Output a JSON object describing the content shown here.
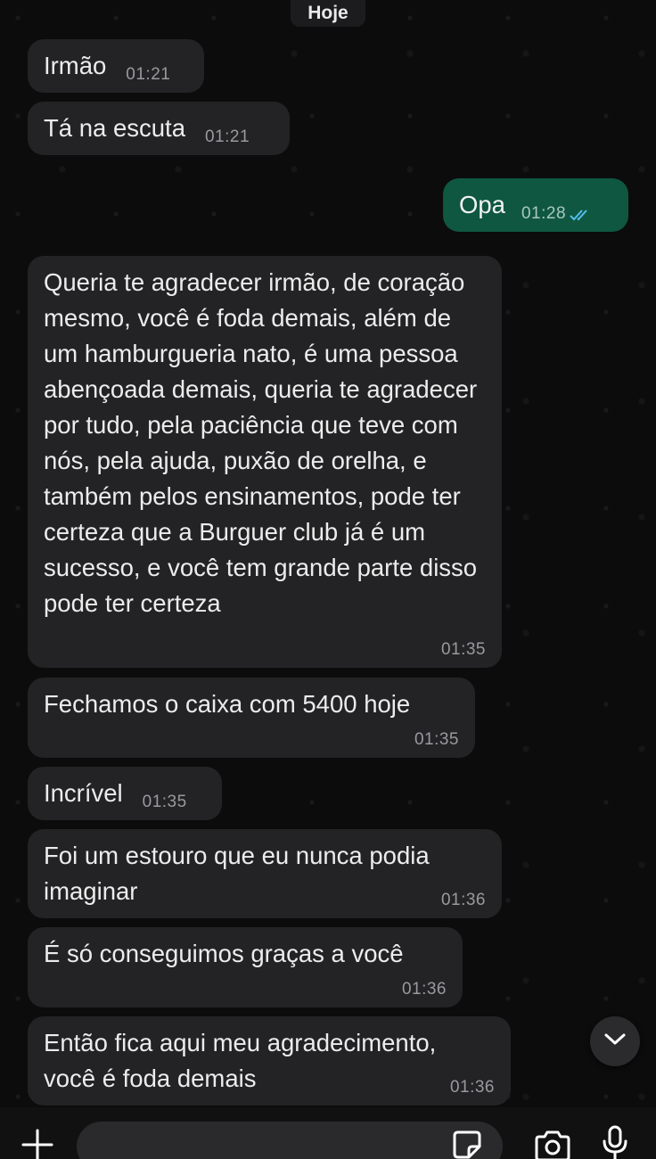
{
  "chat": {
    "date_label": "Hoje",
    "messages": [
      {
        "direction": "in",
        "text": "Irmão",
        "time": "01:21"
      },
      {
        "direction": "in",
        "text": "Tá na escuta",
        "time": "01:21"
      },
      {
        "direction": "out",
        "text": "Opa",
        "time": "01:28",
        "status": "read"
      },
      {
        "direction": "in",
        "text": "Queria te agradecer irmão, de coração mesmo, você é foda demais, além de um hamburgueria nato, é uma pessoa abençoada demais, queria te agradecer por tudo, pela paciência que teve com nós, pela ajuda, puxão de orelha, e também pelos ensinamentos, pode ter certeza que a Burguer club já é um sucesso, e você tem grande parte disso pode ter certeza",
        "time": "01:35"
      },
      {
        "direction": "in",
        "text": "Fechamos o caixa com 5400 hoje",
        "time": "01:35"
      },
      {
        "direction": "in",
        "text": "Incrível",
        "time": "01:35"
      },
      {
        "direction": "in",
        "text": "Foi um estouro que eu nunca podia imaginar",
        "time": "01:36"
      },
      {
        "direction": "in",
        "text": "É só conseguimos graças a você",
        "time": "01:36"
      },
      {
        "direction": "in",
        "text": "Então fica aqui meu agradecimento, você é foda demais",
        "time": "01:36"
      }
    ]
  },
  "composer": {
    "icons": [
      "plus-icon",
      "sticker-icon",
      "camera-icon",
      "microphone-icon"
    ]
  },
  "colors": {
    "incoming_bubble": "#232325",
    "outgoing_bubble": "#0f5741",
    "read_ticks": "#53bdeb",
    "background": "#0c0c0c"
  }
}
